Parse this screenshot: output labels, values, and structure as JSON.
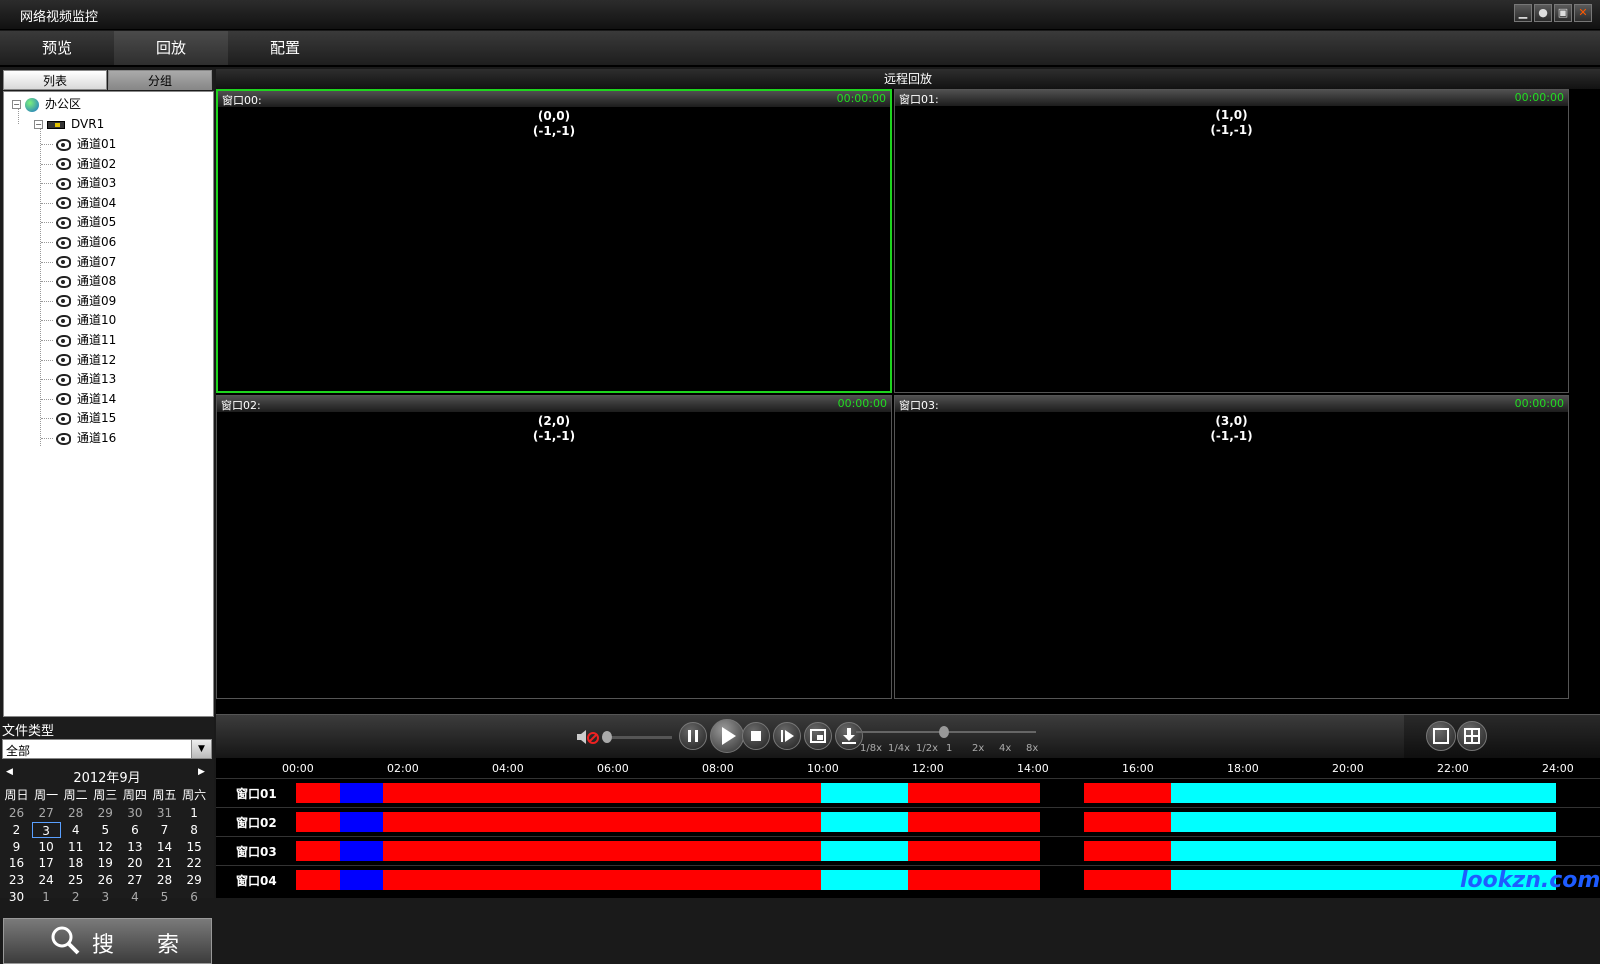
{
  "app_title": "网络视频监控",
  "window_controls": [
    "minimize-icon",
    "user-icon",
    "lock-icon",
    "close-icon"
  ],
  "menu": [
    {
      "label": "预览",
      "active": false
    },
    {
      "label": "回放",
      "active": true
    },
    {
      "label": "配置",
      "active": false
    }
  ],
  "sidebar": {
    "tabs": [
      {
        "label": "列表",
        "active": true
      },
      {
        "label": "分组",
        "active": false
      }
    ],
    "tree": {
      "root": "办公区",
      "device": "DVR1",
      "channels": [
        "通道01",
        "通道02",
        "通道03",
        "通道04",
        "通道05",
        "通道06",
        "通道07",
        "通道08",
        "通道09",
        "通道10",
        "通道11",
        "通道12",
        "通道13",
        "通道14",
        "通道15",
        "通道16"
      ]
    },
    "file_type_label": "文件类型",
    "file_type_value": "全部",
    "calendar": {
      "month": "2012年9月",
      "weekdays": [
        "周日",
        "周一",
        "周二",
        "周三",
        "周四",
        "周五",
        "周六"
      ],
      "weeks": [
        [
          "26",
          "27",
          "28",
          "29",
          "30",
          "31",
          "1"
        ],
        [
          "2",
          "3",
          "4",
          "5",
          "6",
          "7",
          "8"
        ],
        [
          "9",
          "10",
          "11",
          "12",
          "13",
          "14",
          "15"
        ],
        [
          "16",
          "17",
          "18",
          "19",
          "20",
          "21",
          "22"
        ],
        [
          "23",
          "24",
          "25",
          "26",
          "27",
          "28",
          "29"
        ],
        [
          "30",
          "1",
          "2",
          "3",
          "4",
          "5",
          "6"
        ]
      ],
      "selected_day": "3"
    },
    "search_label": "搜 索"
  },
  "main": {
    "title": "远程回放",
    "panes": [
      {
        "name": "窗口00:",
        "time": "00:00:00",
        "coord1": "(0,0)",
        "coord2": "(-1,-1)",
        "selected": true
      },
      {
        "name": "窗口01:",
        "time": "00:00:00",
        "coord1": "(1,0)",
        "coord2": "(-1,-1)",
        "selected": false
      },
      {
        "name": "窗口02:",
        "time": "00:00:00",
        "coord1": "(2,0)",
        "coord2": "(-1,-1)",
        "selected": false
      },
      {
        "name": "窗口03:",
        "time": "00:00:00",
        "coord1": "(3,0)",
        "coord2": "(-1,-1)",
        "selected": false
      }
    ]
  },
  "controls": {
    "buttons": [
      "volume-icon",
      "pause-icon",
      "play-icon",
      "stop-icon",
      "step-forward-icon",
      "capture-icon",
      "download-icon"
    ],
    "speeds": [
      "1/8x",
      "1/4x",
      "1/2x",
      "1",
      "2x",
      "4x",
      "8x"
    ],
    "layout_buttons": [
      "single-layout-icon",
      "quad-layout-icon"
    ]
  },
  "timeline": {
    "ticks": [
      "00:00",
      "02:00",
      "04:00",
      "06:00",
      "08:00",
      "10:00",
      "12:00",
      "14:00",
      "16:00",
      "18:00",
      "20:00",
      "22:00",
      "24:00"
    ],
    "rows": [
      "窗口01",
      "窗口02",
      "窗口03",
      "窗口04"
    ],
    "segments": [
      {
        "start": 0,
        "end": 1.67,
        "color": "#ff0000"
      },
      {
        "start": 1.67,
        "end": 3.33,
        "color": "#0000ff"
      },
      {
        "start": 3.33,
        "end": 20.0,
        "color": "#ff0000"
      },
      {
        "start": 20.0,
        "end": 23.33,
        "color": "#00ffff"
      },
      {
        "start": 23.33,
        "end": 28.33,
        "color": "#ff0000"
      },
      {
        "start": 30.0,
        "end": 33.33,
        "color": "#ff0000"
      },
      {
        "start": 33.33,
        "end": 48.0,
        "color": "#00ffff"
      }
    ],
    "time_scale_hours": 24
  },
  "watermark": "lookzn.com"
}
